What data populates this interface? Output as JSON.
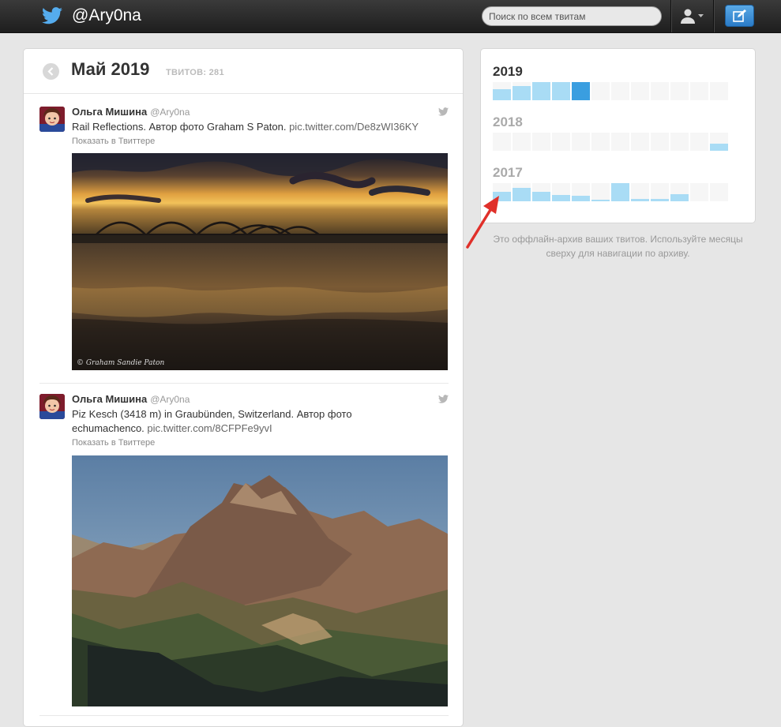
{
  "header": {
    "handle": "@Ary0na",
    "search_placeholder": "Поиск по всем твитам",
    "icons": [
      "twitter-bird-icon",
      "user-icon",
      "chevron-down-icon",
      "compose-icon"
    ]
  },
  "month_view": {
    "title": "Май 2019",
    "count_label": "ТВИТОВ: 281"
  },
  "tweets": [
    {
      "name": "Ольга Мишина",
      "handle": "@Ary0na",
      "text": "Rail Reflections. Автор фото Graham S Paton.",
      "link": "pic.twitter.com/De8zWI36KY",
      "show_label": "Показать в Твиттере",
      "photo_watermark": "© Graham Sandie Paton"
    },
    {
      "name": "Ольга Мишина",
      "handle": "@Ary0na",
      "text": "Piz Kesch (3418 m) in Graubünden, Switzerland. Автор фото echumachenco.",
      "link": "pic.twitter.com/8CFPFe9yvI",
      "show_label": "Показать в Твиттере"
    }
  ],
  "archive": {
    "years": [
      {
        "year": "2019",
        "active": true,
        "months": [
          0.6,
          0.8,
          1.0,
          1.0,
          1.0,
          0,
          0,
          0,
          0,
          0,
          0,
          0
        ],
        "selected_month": 5
      },
      {
        "year": "2018",
        "active": false,
        "months": [
          0,
          0,
          0,
          0,
          0,
          0,
          0,
          0,
          0,
          0,
          0,
          0.4
        ],
        "selected_month": 0
      },
      {
        "year": "2017",
        "active": false,
        "months": [
          0.5,
          0.75,
          0.5,
          0.35,
          0.3,
          0.05,
          1.0,
          0.15,
          0.15,
          0.4,
          0,
          0
        ],
        "selected_month": 0
      }
    ],
    "note": "Это оффлайн-архив ваших твитов. Используйте месяцы сверху для навигации по архиву."
  },
  "colors": {
    "bar": "#a9dcf5",
    "bar_selected": "#3a9ee0",
    "year_active": "#333333",
    "year_inactive": "#aaaaaa",
    "arrow": "#e0302a"
  }
}
